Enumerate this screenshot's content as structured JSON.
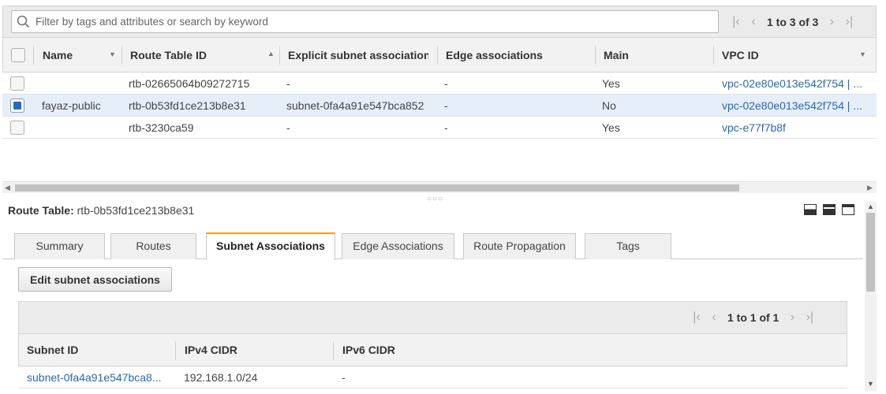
{
  "filter": {
    "placeholder": "Filter by tags and attributes or search by keyword",
    "pager_text": "1 to 3 of 3"
  },
  "table": {
    "columns": [
      "Name",
      "Route Table ID",
      "Explicit subnet association",
      "Edge associations",
      "Main",
      "VPC ID"
    ],
    "rows": [
      {
        "selected": false,
        "name": "",
        "route_table_id": "rtb-02665064b09272715",
        "subnet": "-",
        "edge": "-",
        "main": "Yes",
        "vpc": "vpc-02e80e013e542f754 | ..."
      },
      {
        "selected": true,
        "name": "fayaz-public",
        "route_table_id": "rtb-0b53fd1ce213b8e31",
        "subnet": "subnet-0fa4a91e547bca852",
        "edge": "-",
        "main": "No",
        "vpc": "vpc-02e80e013e542f754 | ..."
      },
      {
        "selected": false,
        "name": "",
        "route_table_id": "rtb-3230ca59",
        "subnet": "-",
        "edge": "-",
        "main": "Yes",
        "vpc": "vpc-e77f7b8f"
      }
    ]
  },
  "details": {
    "label": "Route Table:",
    "value": "rtb-0b53fd1ce213b8e31",
    "tabs": [
      "Summary",
      "Routes",
      "Subnet Associations",
      "Edge Associations",
      "Route Propagation",
      "Tags"
    ],
    "active_tab": "Subnet Associations",
    "edit_button": "Edit subnet associations",
    "pager_text": "1 to 1 of 1",
    "sub_columns": [
      "Subnet ID",
      "IPv4 CIDR",
      "IPv6 CIDR"
    ],
    "sub_rows": [
      {
        "subnet_id": "subnet-0fa4a91e547bca8...",
        "ipv4": "192.168.1.0/24",
        "ipv6": "-"
      }
    ]
  },
  "colors": {
    "accent": "#f39a1b",
    "link": "#2b68b0",
    "selected_row": "#e6eefa",
    "checkbox": "#2a67c9"
  }
}
